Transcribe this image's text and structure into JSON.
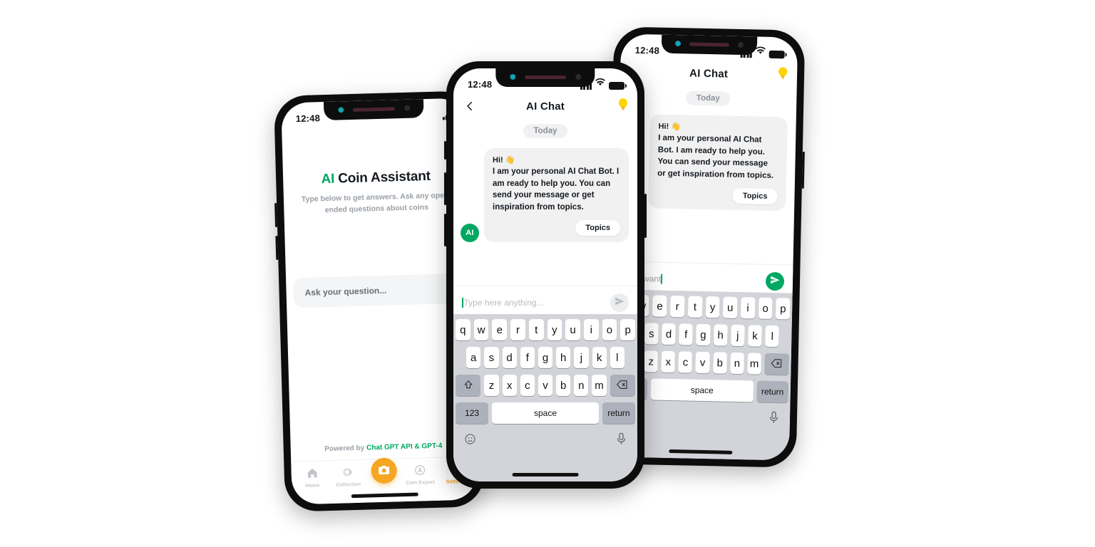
{
  "status_bar": {
    "time": "12:48"
  },
  "left_phone": {
    "title_ai": "AI",
    "title_rest": " Coin Assistant",
    "subtitle": "Type below to get answers. Ask any open-ended questions about coins",
    "ask_placeholder": "Ask your question...",
    "powered_prefix": "Powered by ",
    "powered_brand": "Chat GPT API & GPT-4",
    "tabs": [
      {
        "label": "Home",
        "icon": "home-icon",
        "active": false
      },
      {
        "label": "Collection",
        "icon": "collection-icon",
        "active": false
      },
      {
        "label": "",
        "icon": "camera-icon",
        "active": false
      },
      {
        "label": "Coin Expert",
        "icon": "coin-expert-icon",
        "active": false
      },
      {
        "label": "Settings",
        "icon": "settings-icon",
        "active": true
      }
    ]
  },
  "chat": {
    "nav_title": "AI Chat",
    "back_icon": "back-chevron-icon",
    "bulb_icon": "lightbulb-icon",
    "day_label": "Today",
    "avatar_label": "AI",
    "greeting": "Hi! 👋",
    "message_part1": "I am your personal AI Chat Bot. I am ready to help you. You can send your message or get inspiration from ",
    "message_bold": "topics",
    "message_part3": ".",
    "topics_button": "Topics"
  },
  "middle_phone": {
    "input_placeholder": "Type here anything...",
    "send_icon": "send-icon",
    "send_state": "disabled"
  },
  "right_phone": {
    "input_value": "t it, I want",
    "send_icon": "send-icon",
    "send_state": "active"
  },
  "keyboard": {
    "row1": [
      "q",
      "w",
      "e",
      "r",
      "t",
      "y",
      "u",
      "i",
      "o",
      "p"
    ],
    "row2": [
      "a",
      "s",
      "d",
      "f",
      "g",
      "h",
      "j",
      "k",
      "l"
    ],
    "row3": [
      "z",
      "x",
      "c",
      "v",
      "b",
      "n",
      "m"
    ],
    "shift_icon": "shift-icon",
    "backspace_icon": "backspace-icon",
    "numeric_key": "123",
    "space_key": "space",
    "return_key": "return",
    "emoji_icon": "emoji-icon",
    "mic_icon": "microphone-icon"
  },
  "colors": {
    "green": "#00a862",
    "orange": "#f5a623",
    "bulb_yellow": "#ffd400",
    "bubble_gray": "#f1f1f1",
    "keyboard_bg": "#d2d4da"
  }
}
